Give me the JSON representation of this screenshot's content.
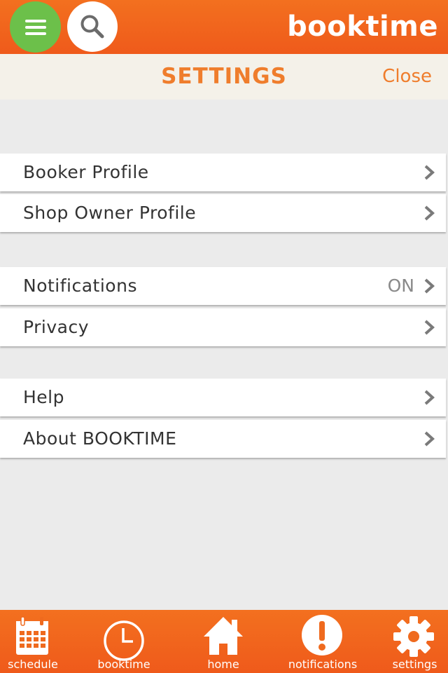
{
  "app": {
    "brand": "booktime",
    "colors": {
      "accent": "#ef7d2c",
      "topbar": "#f06020",
      "menu_button": "#6cc04a",
      "background": "#ebebeb"
    },
    "icons": {
      "menu": "hamburger-icon",
      "search": "search-icon",
      "chevron": "chevron-right-icon"
    }
  },
  "header": {
    "title": "SETTINGS",
    "close_label": "Close"
  },
  "settings": {
    "booker_profile": {
      "label": "Booker Profile"
    },
    "shop_owner_profile": {
      "label": "Shop Owner Profile"
    },
    "notifications": {
      "label": "Notifications",
      "value": "ON"
    },
    "privacy": {
      "label": "Privacy"
    },
    "help": {
      "label": "Help"
    },
    "about": {
      "label": "About BOOKTIME"
    }
  },
  "nav": {
    "schedule": {
      "label": "schedule",
      "icon": "calendar-icon"
    },
    "booktime": {
      "label": "booktime",
      "icon": "clock-icon"
    },
    "home": {
      "label": "home",
      "icon": "home-icon"
    },
    "notifications": {
      "label": "notifications",
      "icon": "alert-icon"
    },
    "settings": {
      "label": "settings",
      "icon": "gear-icon"
    }
  }
}
